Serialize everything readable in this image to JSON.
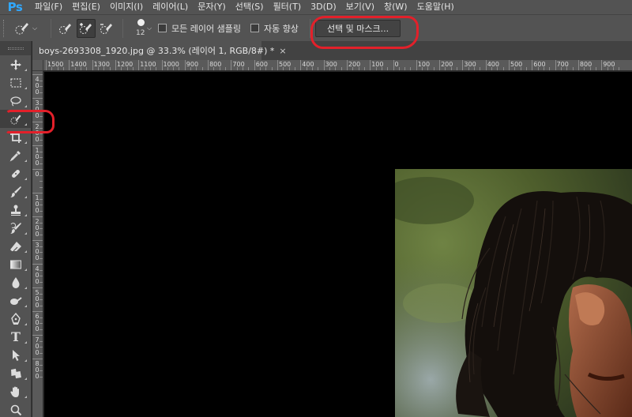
{
  "app": {
    "logo": "Ps",
    "brand_color": "#31a8ff"
  },
  "menu": [
    {
      "label": "파일(F)"
    },
    {
      "label": "편집(E)"
    },
    {
      "label": "이미지(I)"
    },
    {
      "label": "레이어(L)"
    },
    {
      "label": "문자(Y)"
    },
    {
      "label": "선택(S)"
    },
    {
      "label": "필터(T)"
    },
    {
      "label": "3D(D)"
    },
    {
      "label": "보기(V)"
    },
    {
      "label": "창(W)"
    },
    {
      "label": "도움말(H)"
    }
  ],
  "options_bar": {
    "tool_preset_icon": "quick-selection-icon",
    "modes": [
      {
        "icon": "new-selection-brush-icon",
        "active": false
      },
      {
        "icon": "add-to-selection-brush-icon",
        "active": true
      },
      {
        "icon": "subtract-from-selection-brush-icon",
        "active": false
      }
    ],
    "brush_size": "12",
    "sample_all_layers": {
      "label": "모든 레이어 샘플링",
      "checked": false
    },
    "auto_enhance": {
      "label": "자동 향상",
      "checked": false
    },
    "select_and_mask_label": "선택 및 마스크..."
  },
  "document": {
    "tab_title": "boys-2693308_1920.jpg @ 33.3% (레이어 1, RGB/8#) *",
    "close_glyph": "×"
  },
  "ruler": {
    "h_labels": [
      "1500",
      "1400",
      "1300",
      "1200",
      "1100",
      "1000",
      "900",
      "800",
      "700",
      "600",
      "500",
      "400",
      "300",
      "200",
      "100",
      "0",
      "100",
      "200",
      "300",
      "400",
      "500",
      "600",
      "700",
      "800",
      "900"
    ],
    "v_labels": [
      "4",
      "3",
      "2",
      "1",
      "0",
      "1",
      "2",
      "3",
      "4",
      "5",
      "6",
      "7",
      "8"
    ]
  },
  "tools": [
    {
      "name": "move-tool",
      "icon": "move-icon"
    },
    {
      "name": "marquee-tool",
      "icon": "rect-marquee-icon"
    },
    {
      "name": "lasso-tool",
      "icon": "lasso-icon"
    },
    {
      "name": "quick-selection-tool",
      "icon": "quick-selection-icon",
      "active": true
    },
    {
      "name": "crop-tool",
      "icon": "crop-icon"
    },
    {
      "name": "eyedropper-tool",
      "icon": "eyedropper-icon"
    },
    {
      "name": "healing-brush-tool",
      "icon": "bandage-icon"
    },
    {
      "name": "brush-tool",
      "icon": "brush-icon"
    },
    {
      "name": "clone-stamp-tool",
      "icon": "stamp-icon"
    },
    {
      "name": "history-brush-tool",
      "icon": "history-brush-icon"
    },
    {
      "name": "eraser-tool",
      "icon": "eraser-icon"
    },
    {
      "name": "gradient-tool",
      "icon": "gradient-icon"
    },
    {
      "name": "blur-tool",
      "icon": "drop-icon"
    },
    {
      "name": "dodge-tool",
      "icon": "dodge-icon"
    },
    {
      "name": "pen-tool",
      "icon": "pen-icon"
    },
    {
      "name": "type-tool",
      "icon": "type-icon",
      "glyph": "T"
    },
    {
      "name": "path-selection-tool",
      "icon": "arrow-icon"
    },
    {
      "name": "custom-shape-tool",
      "icon": "shape-icon"
    },
    {
      "name": "hand-tool",
      "icon": "hand-icon"
    },
    {
      "name": "zoom-tool",
      "icon": "zoom-icon"
    }
  ],
  "colors": {
    "annotation_red": "#e3202a",
    "panel": "#535353",
    "canvas": "#000000"
  }
}
